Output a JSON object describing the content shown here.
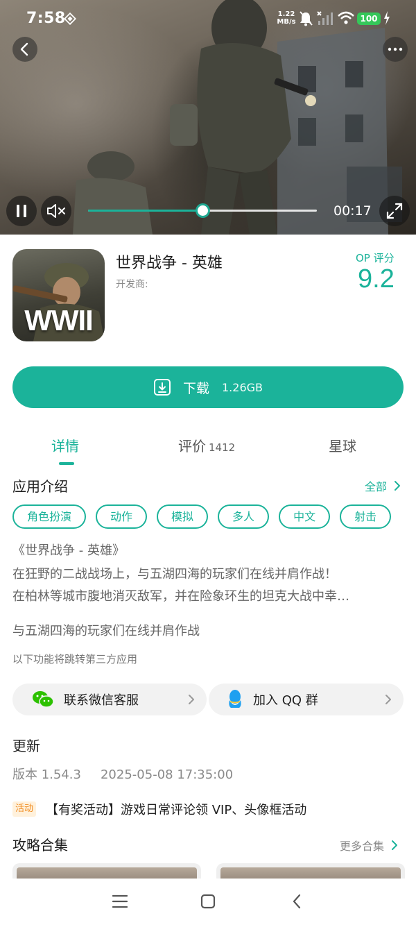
{
  "status_bar": {
    "time": "7:58",
    "net_speed_value": "1.22",
    "net_speed_unit": "MB/s",
    "battery": "100"
  },
  "player": {
    "elapsed": "00:17",
    "progress_fraction": 0.5,
    "muted": true,
    "state": "playing"
  },
  "app": {
    "title": "世界战争 - 英雄",
    "developer_label": "开发商:",
    "icon_text": "WWII",
    "score_label": "OP 评分",
    "score": "9.2"
  },
  "download": {
    "label": "下载",
    "size": "1.26GB"
  },
  "tabs": [
    {
      "label": "详情",
      "count": "",
      "active": true
    },
    {
      "label": "评价",
      "count": "1412",
      "active": false
    },
    {
      "label": "星球",
      "count": "",
      "active": false
    }
  ],
  "intro": {
    "title": "应用介绍",
    "all_label": "全部",
    "tags": [
      "角色扮演",
      "动作",
      "模拟",
      "多人",
      "中文",
      "射击"
    ],
    "desc_lines": [
      "《世界战争 - 英雄》",
      "在狂野的二战战场上，与五湖四海的玩家们在线并肩作战！",
      "在柏林等城市腹地消灭敌军，并在险象环生的坦克大战中幸…"
    ],
    "summary": "与五湖四海的玩家们在线并肩作战",
    "third_party_note": "以下功能将跳转第三方应用"
  },
  "contacts": {
    "wechat_label": "联系微信客服",
    "qq_label": "加入 QQ 群"
  },
  "update": {
    "title": "更新",
    "version": "版本 1.54.3",
    "date": "2025-05-08 17:35:00"
  },
  "event": {
    "badge": "活动",
    "text": "【有奖活动】游戏日常评论领 VIP、头像框活动"
  },
  "guides": {
    "title": "攻略合集",
    "more_label": "更多合集"
  },
  "colors": {
    "accent": "#1bb39a",
    "event_badge_bg": "#fff1dc",
    "event_badge_text": "#f08a1c",
    "battery": "#35c759"
  }
}
